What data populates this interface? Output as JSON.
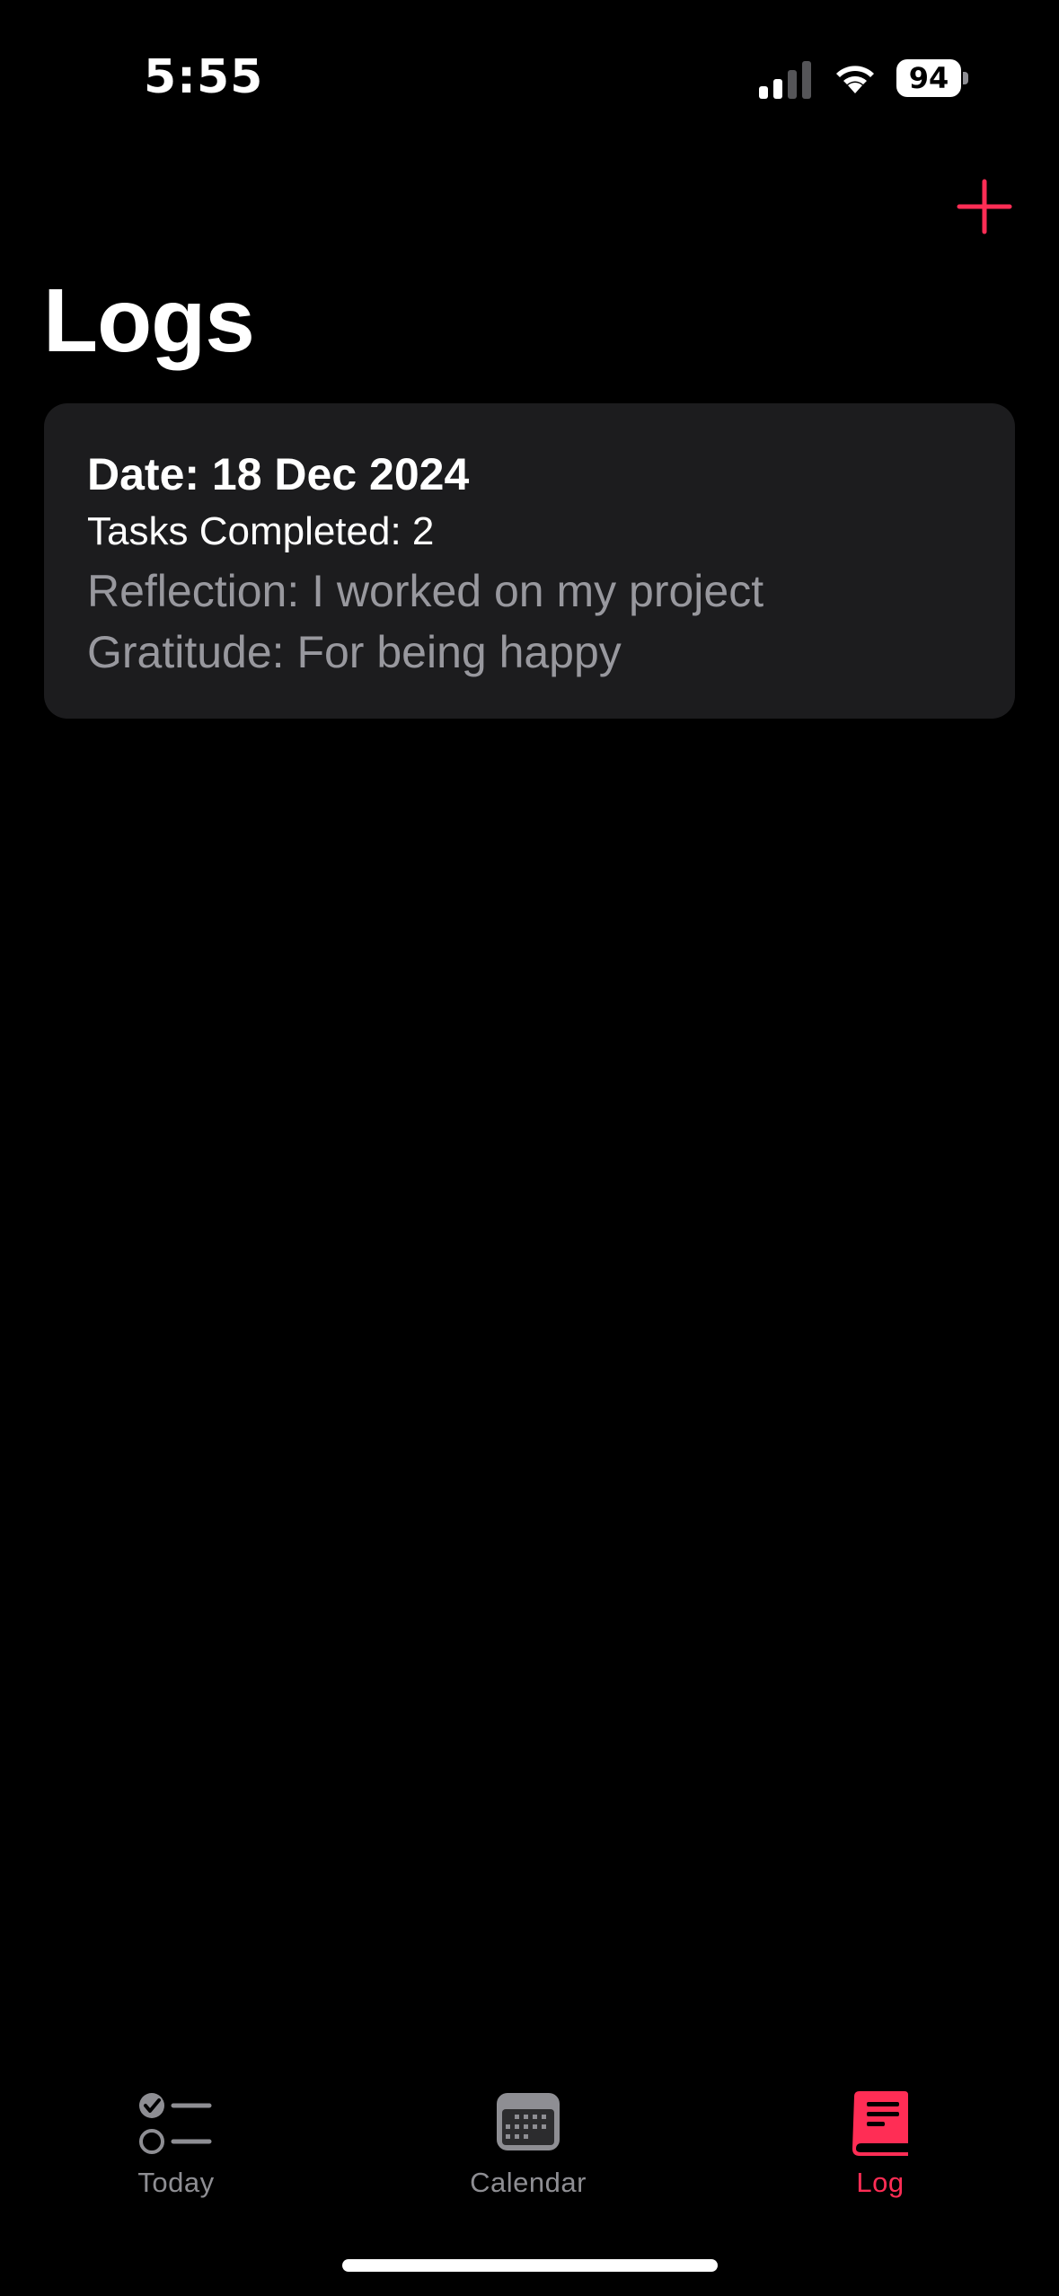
{
  "status_bar": {
    "time": "5:55",
    "battery": "94"
  },
  "header": {
    "add_icon": "plus-icon",
    "title": "Logs"
  },
  "logs": [
    {
      "date": "Date: 18 Dec 2024",
      "tasks": "Tasks Completed: 2",
      "reflection": "Reflection: I worked on my project",
      "gratitude": "Gratitude: For being happy"
    }
  ],
  "tab_bar": {
    "tabs": [
      {
        "label": "Today",
        "icon": "checklist-icon",
        "active": false
      },
      {
        "label": "Calendar",
        "icon": "calendar-icon",
        "active": false
      },
      {
        "label": "Log",
        "icon": "book-icon",
        "active": true
      }
    ]
  },
  "colors": {
    "accent": "#ff2d55",
    "background": "#000000",
    "card": "#1c1c1e",
    "secondary_text": "#98989e",
    "inactive_tab": "#8e8e93"
  }
}
